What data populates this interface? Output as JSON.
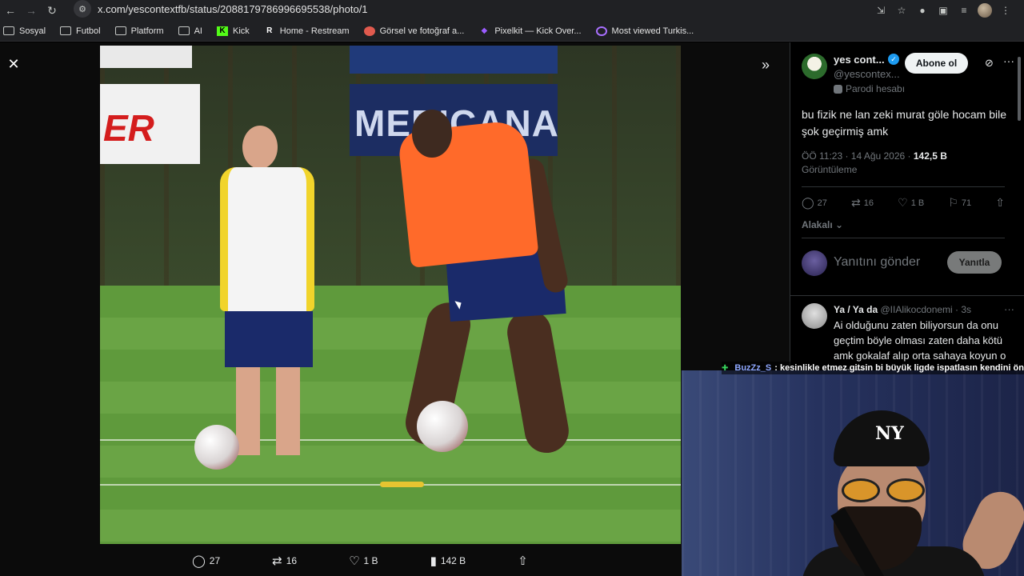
{
  "browser": {
    "url": "x.com/yescontextfb/status/2088179786996695538/photo/1",
    "bookmarks": [
      {
        "label": "Sosyal",
        "icon": "folder-icon"
      },
      {
        "label": "Futbol",
        "icon": "folder-icon"
      },
      {
        "label": "Platform",
        "icon": "folder-icon"
      },
      {
        "label": "AI",
        "icon": "folder-icon"
      },
      {
        "label": "Kick",
        "icon": "kick-icon"
      },
      {
        "label": "Home - Restream",
        "icon": "restream-icon"
      },
      {
        "label": "Görsel ve fotoğraf a...",
        "icon": "image-icon"
      },
      {
        "label": "Pixelkit — Kick Over...",
        "icon": "pixelkit-icon"
      },
      {
        "label": "Most viewed Turkis...",
        "icon": "twitch-icon"
      }
    ]
  },
  "photo_actions": {
    "replies": "27",
    "reposts": "16",
    "likes": "1 B",
    "views": "142 B"
  },
  "tweet": {
    "name": "yes cont...",
    "handle": "@yescontex...",
    "follow_label": "Abone ol",
    "parody_label": "Parodi hesabı",
    "text": "bu fizik ne lan zeki murat göle hocam bile şok geçirmiş amk",
    "time": "ÖÖ 11:23 · 14 Ağu 2026 · ",
    "views_count": "142,5 B",
    "views_label": "Görüntüleme",
    "actions": {
      "replies": "27",
      "reposts": "16",
      "likes": "1 B",
      "bookmarks": "71"
    },
    "relevant_label": "Alakalı",
    "reply_placeholder": "Yanıtını gönder",
    "reply_button": "Yanıtla"
  },
  "reply": {
    "name": "Ya / Ya da",
    "handle": "@IIAlikocdonemi · 3s",
    "text": "Ai olduğunu zaten biliyorsun da onu geçtim böyle olması zaten daha kötü amk gokalaf alıp orta sahaya koyun o zaman"
  },
  "chat": {
    "user": "BuzZz_S",
    "message": ": kesinlikle etmez gitsin bi büyük ligde ispatlasın kendini önce"
  },
  "colors": {
    "accent": "#1d9bf0",
    "background": "#000000",
    "muted": "#71767b"
  }
}
